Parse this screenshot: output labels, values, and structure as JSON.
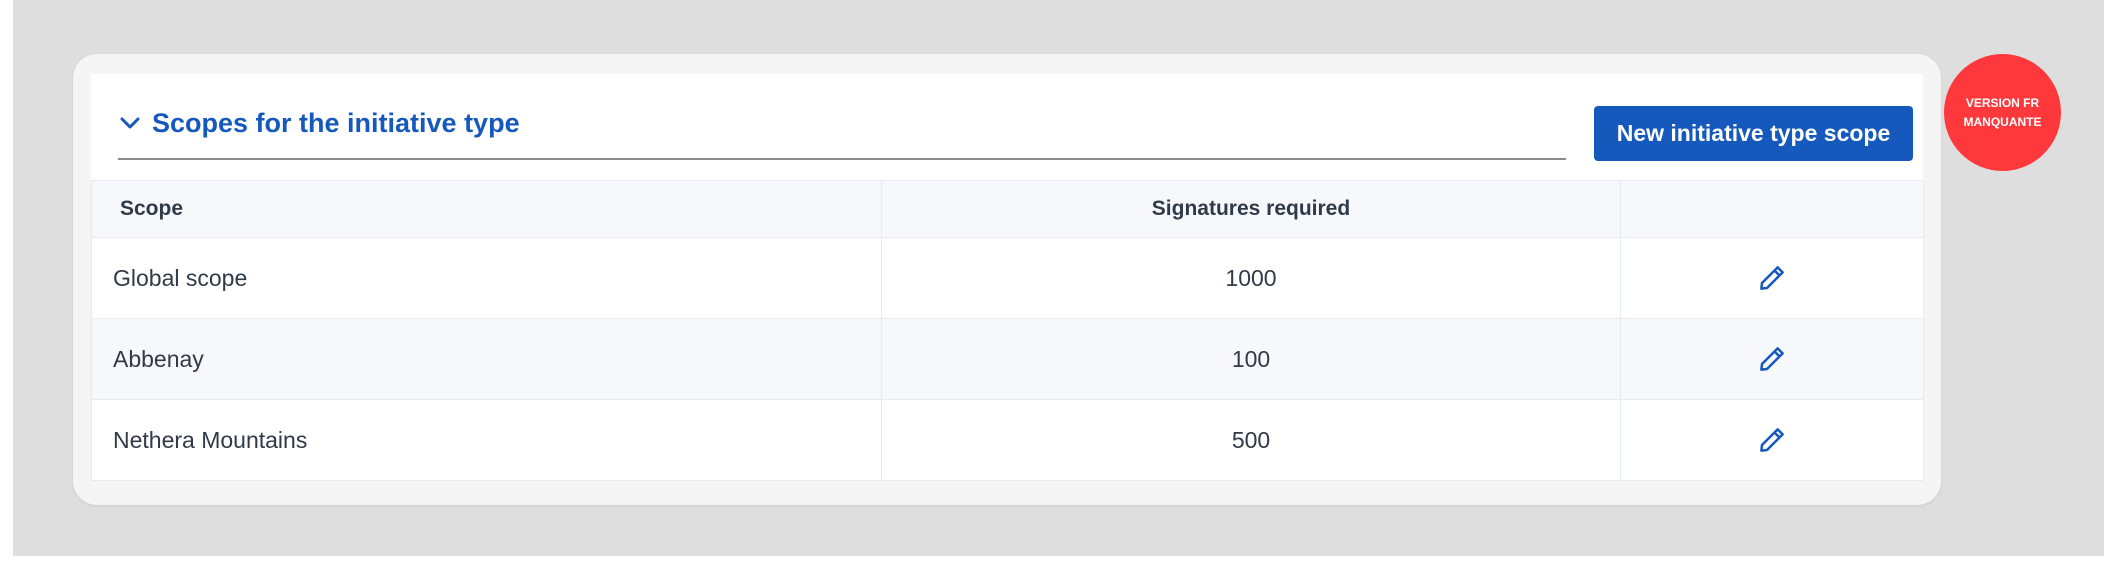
{
  "section": {
    "title": "Scopes for the initiative type",
    "chevron_icon": "chevron-down-icon",
    "new_button_label": "New initiative type scope"
  },
  "table": {
    "columns": [
      "Scope",
      "Signatures required",
      ""
    ],
    "rows": [
      {
        "scope": "Global scope",
        "signatures": "1000",
        "action_icon": "pencil-icon"
      },
      {
        "scope": "Abbenay",
        "signatures": "100",
        "action_icon": "pencil-icon"
      },
      {
        "scope": "Nethera Mountains",
        "signatures": "500",
        "action_icon": "pencil-icon"
      }
    ]
  },
  "badge": {
    "line1": "VERSION FR",
    "line2": "MANQUANTE"
  },
  "colors": {
    "accent": "#1659bd",
    "badge": "#ff383c",
    "text": "#303a48",
    "background": "#dedede"
  }
}
